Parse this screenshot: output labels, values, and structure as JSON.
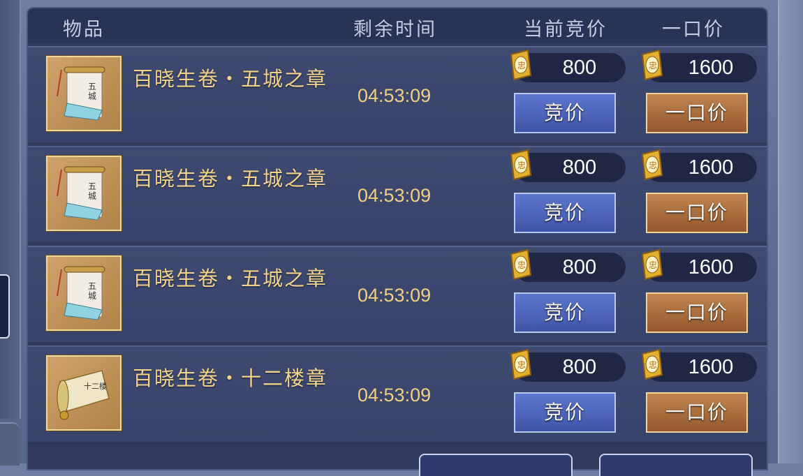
{
  "header": {
    "item_col": "物品",
    "time_col": "剩余时间",
    "current_bid_col": "当前竞价",
    "buyout_col": "一口价"
  },
  "rows": [
    {
      "name": "百晓生卷・五城之章",
      "time_left": "04:53:09",
      "current_bid": "800",
      "buyout_price": "1600",
      "bid_label": "竞价",
      "buyout_label": "一口价",
      "thumb_icon": "scroll-five-cities-icon"
    },
    {
      "name": "百晓生卷・五城之章",
      "time_left": "04:53:09",
      "current_bid": "800",
      "buyout_price": "1600",
      "bid_label": "竞价",
      "buyout_label": "一口价",
      "thumb_icon": "scroll-five-cities-icon"
    },
    {
      "name": "百晓生卷・五城之章",
      "time_left": "04:53:09",
      "current_bid": "800",
      "buyout_price": "1600",
      "bid_label": "竞价",
      "buyout_label": "一口价",
      "thumb_icon": "scroll-five-cities-icon"
    },
    {
      "name": "百晓生卷・十二楼章",
      "time_left": "04:53:09",
      "current_bid": "800",
      "buyout_price": "1600",
      "bid_label": "竞价",
      "buyout_label": "一口价",
      "thumb_icon": "scroll-twelve-towers-icon"
    }
  ],
  "currency_icon": "gold-ticket-icon",
  "colors": {
    "item_name": "#f3d28a",
    "time": "#f0cf82",
    "bid_button": "#4a62bd",
    "buyout_button": "#ad6f3e"
  }
}
